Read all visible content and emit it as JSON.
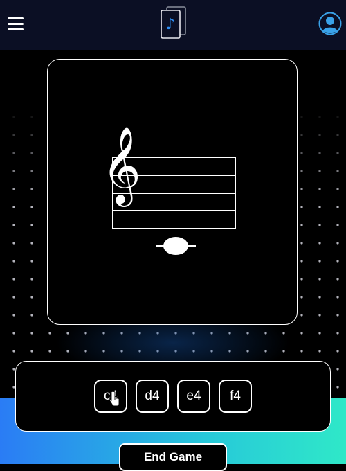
{
  "header": {
    "menu_icon": "hamburger-menu-icon",
    "logo_icon": "music-note-cards-icon",
    "avatar_icon": "user-avatar-icon",
    "bg_color": "#0b0f24",
    "accent_color": "#2d8cf0"
  },
  "staff": {
    "clef": "treble-clef",
    "note": "c4",
    "glyph": "𝄞"
  },
  "answers": {
    "options": [
      "c4",
      "d4",
      "e4",
      "f4"
    ]
  },
  "footer": {
    "end_game_label": "End Game",
    "gradient_colors": [
      "#2a7cf5",
      "#2fe8c8"
    ]
  }
}
